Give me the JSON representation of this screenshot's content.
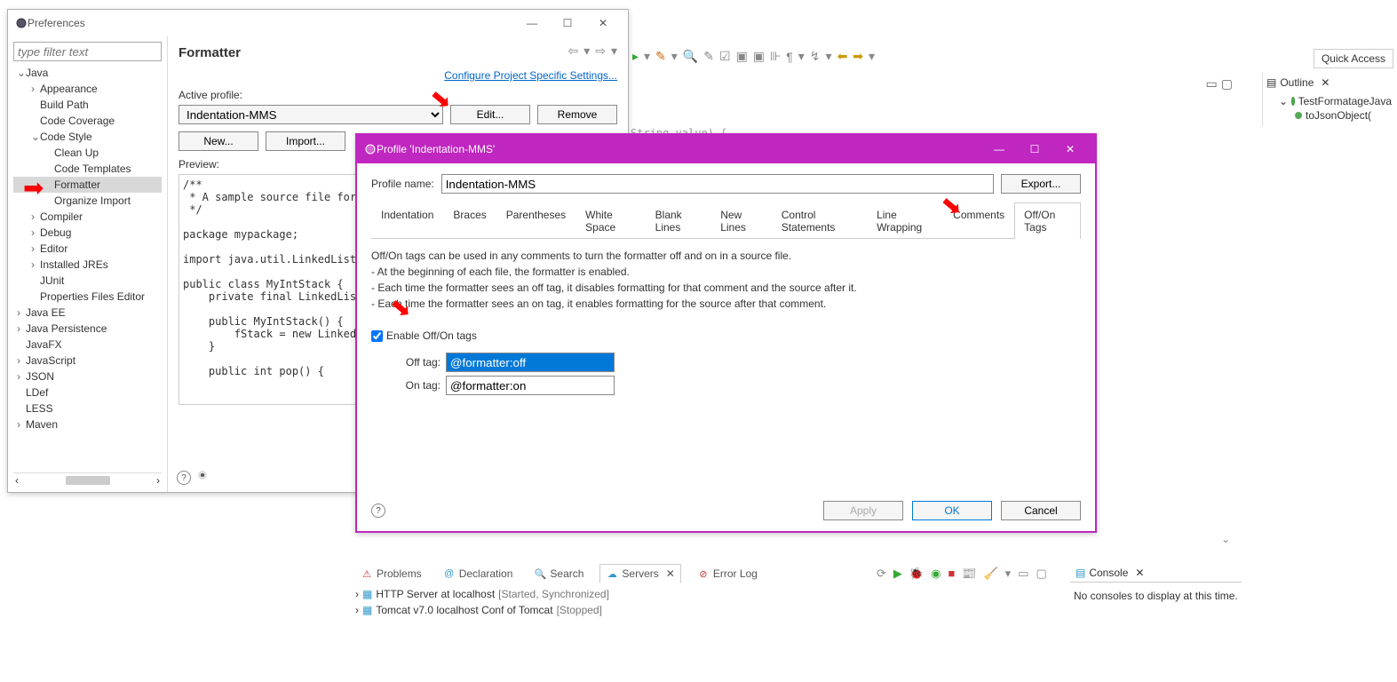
{
  "prefs_window": {
    "title": "Preferences",
    "filter_placeholder": "type filter text",
    "heading": "Formatter",
    "config_link": "Configure Project Specific Settings...",
    "active_profile_label": "Active profile:",
    "active_profile_value": "Indentation-MMS",
    "edit_btn": "Edit...",
    "remove_btn": "Remove",
    "new_btn": "New...",
    "import_btn": "Import...",
    "preview_label": "Preview:",
    "preview_code": "/**\n * A sample source file for\n */\n\npackage mypackage;\n\nimport java.util.LinkedList\n\npublic class MyIntStack {\n    private final LinkedList\n\n    public MyIntStack() {\n        fStack = new LinkedList\n    }\n\n    public int pop() {"
  },
  "tree": [
    {
      "lvl": 0,
      "label": "Java",
      "exp": true
    },
    {
      "lvl": 1,
      "label": "Appearance",
      "exp": false,
      "twisty": true
    },
    {
      "lvl": 1,
      "label": "Build Path"
    },
    {
      "lvl": 1,
      "label": "Code Coverage"
    },
    {
      "lvl": 1,
      "label": "Code Style",
      "exp": true,
      "twisty": true
    },
    {
      "lvl": 2,
      "label": "Clean Up"
    },
    {
      "lvl": 2,
      "label": "Code Templates"
    },
    {
      "lvl": 2,
      "label": "Formatter",
      "selected": true
    },
    {
      "lvl": 2,
      "label": "Organize Import"
    },
    {
      "lvl": 1,
      "label": "Compiler",
      "twisty": true
    },
    {
      "lvl": 1,
      "label": "Debug",
      "twisty": true
    },
    {
      "lvl": 1,
      "label": "Editor",
      "twisty": true
    },
    {
      "lvl": 1,
      "label": "Installed JREs",
      "twisty": true
    },
    {
      "lvl": 1,
      "label": "JUnit"
    },
    {
      "lvl": 1,
      "label": "Properties Files Editor"
    },
    {
      "lvl": 0,
      "label": "Java EE",
      "twisty": true
    },
    {
      "lvl": 0,
      "label": "Java Persistence",
      "twisty": true
    },
    {
      "lvl": 0,
      "label": "JavaFX"
    },
    {
      "lvl": 0,
      "label": "JavaScript",
      "twisty": true
    },
    {
      "lvl": 0,
      "label": "JSON",
      "twisty": true
    },
    {
      "lvl": 0,
      "label": "LDef"
    },
    {
      "lvl": 0,
      "label": "LESS"
    },
    {
      "lvl": 0,
      "label": "Maven",
      "twisty": true
    }
  ],
  "dialog": {
    "title": "Profile 'Indentation-MMS'",
    "profile_name_label": "Profile name:",
    "profile_name_value": "Indentation-MMS",
    "export_btn": "Export...",
    "tabs": [
      "Indentation",
      "Braces",
      "Parentheses",
      "White Space",
      "Blank Lines",
      "New Lines",
      "Control Statements",
      "Line Wrapping",
      "Comments",
      "Off/On Tags"
    ],
    "active_tab": "Off/On Tags",
    "desc_line1": "Off/On tags can be used in any comments to turn the formatter off and on in a source file.",
    "desc_line2": "- At the beginning of each file, the formatter is enabled.",
    "desc_line3": "- Each time the formatter sees an off tag, it disables formatting for that comment and the source after it.",
    "desc_line4": "- Each time the formatter sees an on tag, it enables formatting for the source after that comment.",
    "enable_label": "Enable Off/On tags",
    "enable_checked": true,
    "off_tag_label": "Off tag:",
    "off_tag_value": "@formatter:off",
    "on_tag_label": "On tag:",
    "on_tag_value": "@formatter:on",
    "apply_btn": "Apply",
    "ok_btn": "OK",
    "cancel_btn": "Cancel"
  },
  "outline": {
    "title": "Outline",
    "item1": "TestFormatageJava",
    "item2": "toJsonObject("
  },
  "quick_access": "Quick Access",
  "bottom_tabs": {
    "problems": "Problems",
    "declaration": "Declaration",
    "search": "Search",
    "servers": "Servers",
    "error_log": "Error Log"
  },
  "servers": {
    "s1_name": "HTTP Server at localhost",
    "s1_state": "[Started, Synchronized]",
    "s2_name": "Tomcat v7.0 localhost Conf of Tomcat",
    "s2_state": "[Stopped]"
  },
  "console": {
    "title": "Console",
    "msg": "No consoles to display at this time."
  },
  "bg_code": "String value) {"
}
